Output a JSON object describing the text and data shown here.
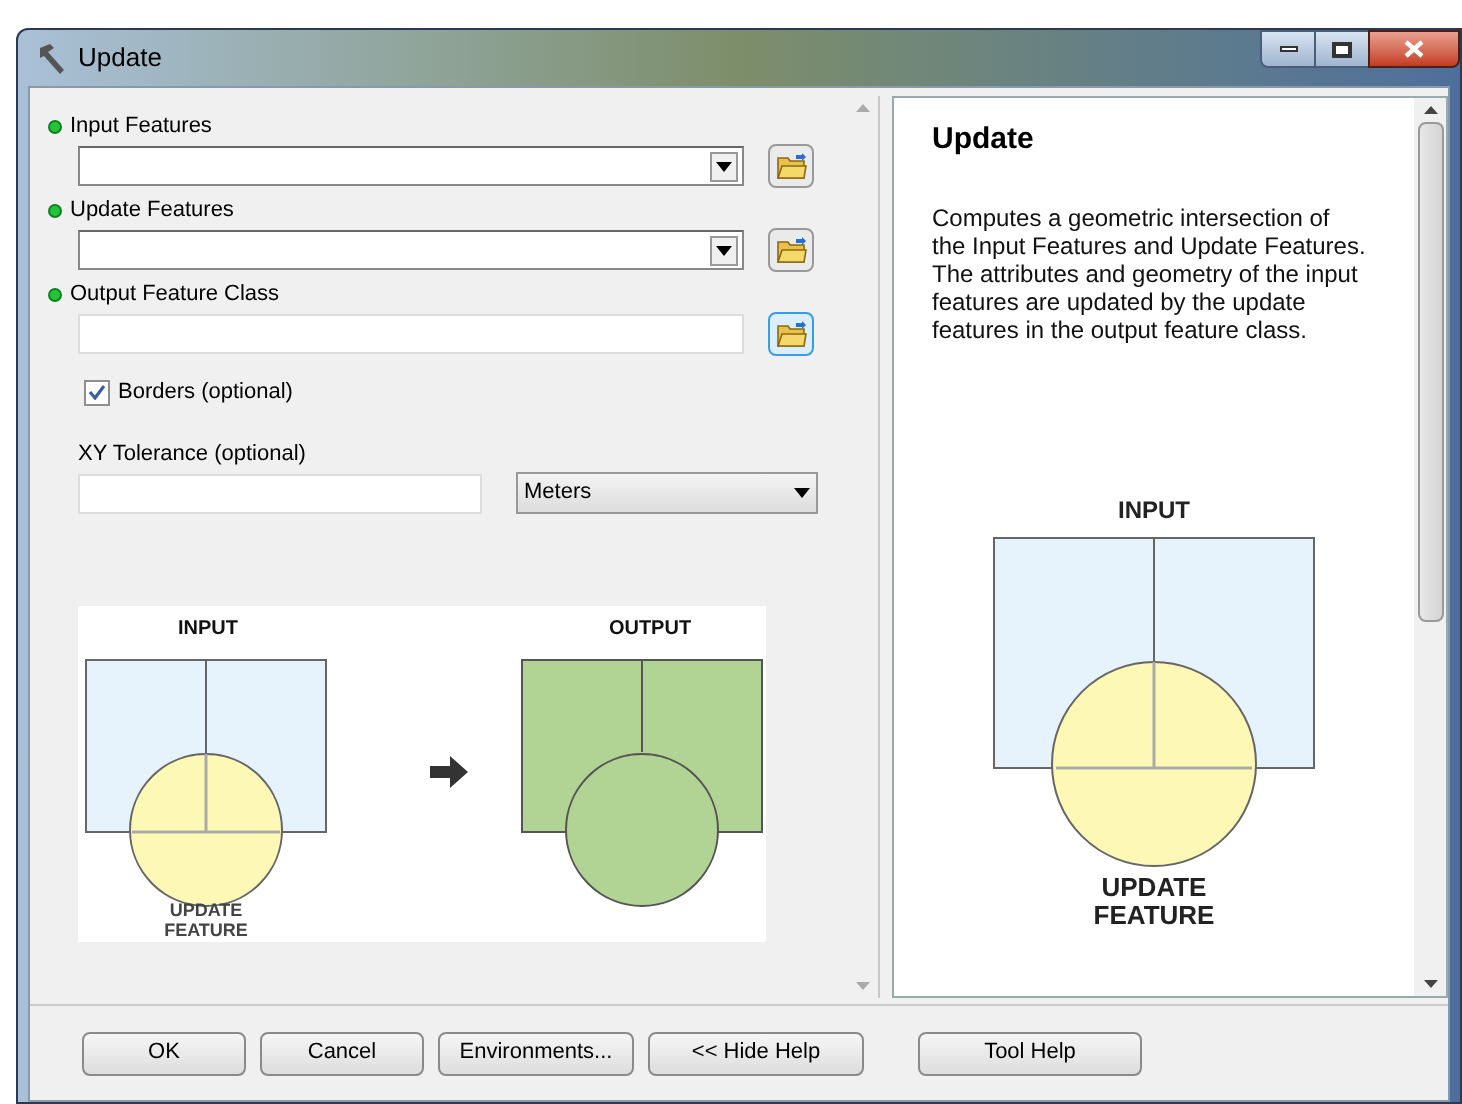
{
  "window": {
    "title": "Update"
  },
  "parameters": [
    {
      "kind": "dropdown",
      "label": "Input Features",
      "required": true,
      "focused": false
    },
    {
      "kind": "dropdown",
      "label": "Update Features",
      "required": true,
      "focused": false
    },
    {
      "kind": "text",
      "label": "Output Feature Class",
      "required": true,
      "focused": true
    }
  ],
  "borders": {
    "label": "Borders (optional)",
    "checked": true
  },
  "xy_tolerance": {
    "label": "XY Tolerance (optional)",
    "unit": "Meters"
  },
  "diagram": {
    "input_label": "INPUT",
    "output_label": "OUTPUT",
    "update_label": [
      "UPDATE",
      "FEATURE"
    ]
  },
  "help": {
    "title": "Update",
    "description": "Computes a geometric intersection of the Input Features and Update Features. The attributes and geometry of the input features are updated by the update features in the output feature class.",
    "input_label": "INPUT",
    "update_label": [
      "UPDATE",
      "FEATURE"
    ]
  },
  "buttons": [
    "OK",
    "Cancel",
    "Environments...",
    "<< Hide Help",
    "Tool Help"
  ]
}
